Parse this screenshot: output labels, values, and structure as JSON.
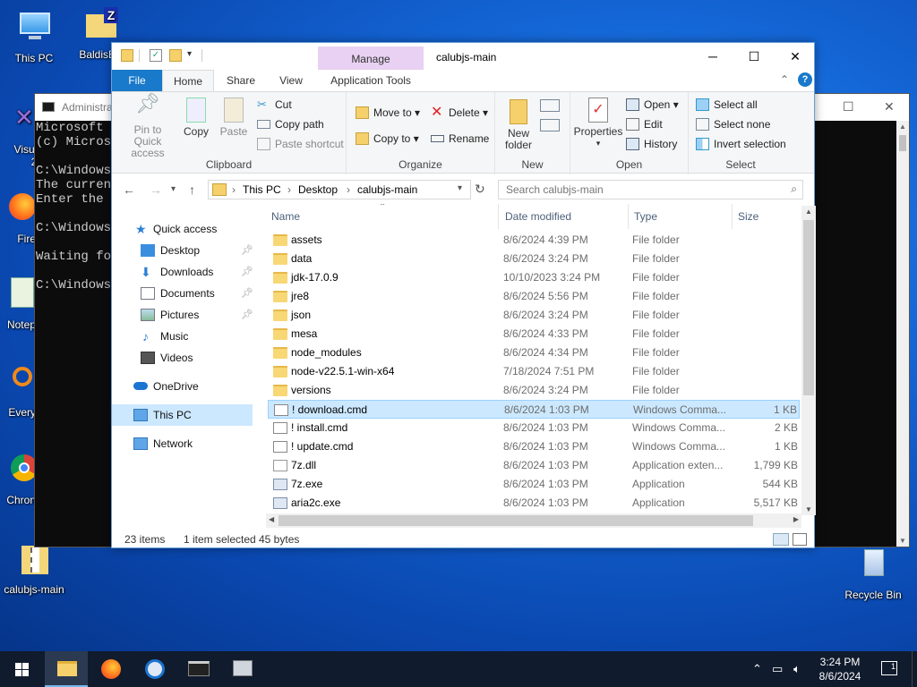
{
  "desktop": {
    "icons": [
      {
        "label": "This PC"
      },
      {
        "label": "BaldisBa"
      },
      {
        "label": "Visual"
      },
      {
        "label": "20"
      },
      {
        "label": "Fire"
      },
      {
        "label": "Notep"
      },
      {
        "label": "Every"
      },
      {
        "label": "Chron"
      },
      {
        "label": "calubjs-main"
      },
      {
        "label": "Recycle Bin"
      }
    ]
  },
  "console": {
    "title": "Administra",
    "lines": [
      "Microsoft W",
      "(c) Microso",
      "",
      "C:\\Windows\\",
      "The current",
      "Enter the r",
      "",
      "C:\\Windows\\",
      "",
      "Waiting for",
      "",
      "C:\\Windows\\"
    ]
  },
  "explorer": {
    "title": "calubjs-main",
    "manage_label": "Manage",
    "tabs": {
      "file": "File",
      "home": "Home",
      "share": "Share",
      "view": "View",
      "app_tools": "Application Tools"
    },
    "ribbon": {
      "clipboard": {
        "pin": "Pin to Quick access",
        "copy": "Copy",
        "paste": "Paste",
        "cut": "Cut",
        "copy_path": "Copy path",
        "paste_shortcut": "Paste shortcut",
        "label": "Clipboard"
      },
      "organize": {
        "move_to": "Move to",
        "copy_to": "Copy to",
        "delete": "Delete",
        "rename": "Rename",
        "label": "Organize"
      },
      "new": {
        "new_folder": "New folder",
        "label": "New"
      },
      "open": {
        "properties": "Properties",
        "open": "Open",
        "edit": "Edit",
        "history": "History",
        "label": "Open"
      },
      "select": {
        "select_all": "Select all",
        "select_none": "Select none",
        "invert": "Invert selection",
        "label": "Select"
      }
    },
    "address": {
      "segments": [
        "This PC",
        "Desktop",
        "calubjs-main"
      ]
    },
    "search": {
      "placeholder": "Search calubjs-main"
    },
    "nav": [
      {
        "label": "Quick access"
      },
      {
        "label": "Desktop"
      },
      {
        "label": "Downloads"
      },
      {
        "label": "Documents"
      },
      {
        "label": "Pictures"
      },
      {
        "label": "Music"
      },
      {
        "label": "Videos"
      },
      {
        "label": "OneDrive"
      },
      {
        "label": "This PC"
      },
      {
        "label": "Network"
      }
    ],
    "columns": {
      "name": "Name",
      "date": "Date modified",
      "type": "Type",
      "size": "Size"
    },
    "files": [
      {
        "name": "assets",
        "date": "8/6/2024 4:39 PM",
        "type": "File folder",
        "size": ""
      },
      {
        "name": "data",
        "date": "8/6/2024 3:24 PM",
        "type": "File folder",
        "size": ""
      },
      {
        "name": "jdk-17.0.9",
        "date": "10/10/2023 3:24 PM",
        "type": "File folder",
        "size": ""
      },
      {
        "name": "jre8",
        "date": "8/6/2024 5:56 PM",
        "type": "File folder",
        "size": ""
      },
      {
        "name": "json",
        "date": "8/6/2024 3:24 PM",
        "type": "File folder",
        "size": ""
      },
      {
        "name": "mesa",
        "date": "8/6/2024 4:33 PM",
        "type": "File folder",
        "size": ""
      },
      {
        "name": "node_modules",
        "date": "8/6/2024 4:34 PM",
        "type": "File folder",
        "size": ""
      },
      {
        "name": "node-v22.5.1-win-x64",
        "date": "7/18/2024 7:51 PM",
        "type": "File folder",
        "size": ""
      },
      {
        "name": "versions",
        "date": "8/6/2024 3:24 PM",
        "type": "File folder",
        "size": ""
      },
      {
        "name": "! download.cmd",
        "date": "8/6/2024 1:03 PM",
        "type": "Windows Comma...",
        "size": "1 KB"
      },
      {
        "name": "! install.cmd",
        "date": "8/6/2024 1:03 PM",
        "type": "Windows Comma...",
        "size": "2 KB"
      },
      {
        "name": "! update.cmd",
        "date": "8/6/2024 1:03 PM",
        "type": "Windows Comma...",
        "size": "1 KB"
      },
      {
        "name": "7z.dll",
        "date": "8/6/2024 1:03 PM",
        "type": "Application exten...",
        "size": "1,799 KB"
      },
      {
        "name": "7z.exe",
        "date": "8/6/2024 1:03 PM",
        "type": "Application",
        "size": "544 KB"
      },
      {
        "name": "aria2c.exe",
        "date": "8/6/2024 1:03 PM",
        "type": "Application",
        "size": "5,517 KB"
      }
    ],
    "status": {
      "count": "23 items",
      "selected": "1 item selected",
      "size": "45 bytes"
    }
  },
  "taskbar": {
    "time": "3:24 PM",
    "date": "8/6/2024",
    "notifications": "1"
  },
  "colors": {
    "accent": "#1979ca",
    "selection": "#cce8ff",
    "taskbar": "#101b2d"
  }
}
